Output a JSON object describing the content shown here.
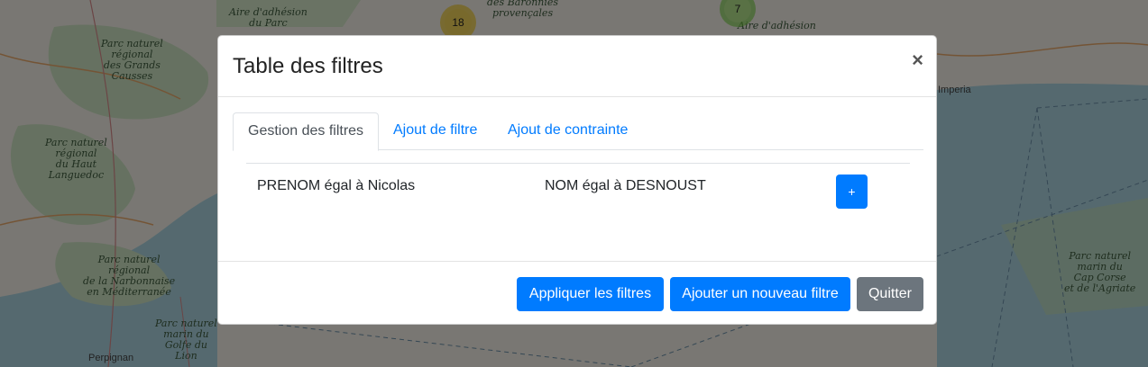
{
  "map": {
    "labels": {
      "aire_parc_1": "Aire d'adhésion\ndu Parc",
      "grands_causses": "Parc naturel\nrégional\ndes Grands\nCausses",
      "haut_languedoc": "Parc naturel\nrégional\ndu Haut\nLanguedoc",
      "narbonnaise": "Parc naturel\nrégional\nde la Narbonnaise\nen Méditerranée",
      "golfe_lion": "Parc naturel\nmarin du\nGolfe du\nLion",
      "baronnies": "des Baronnies\nprovençales",
      "aire_adhesion_2": "Aire d'adhésion",
      "imperia": "Imperia",
      "cap_corse": "Parc naturel\nmarin du\nCap Corse\net de l'Agriate",
      "perpignan": "Perpignan"
    },
    "clusters": {
      "yellow_count": "18",
      "green_count": "7"
    }
  },
  "modal": {
    "title": "Table des filtres",
    "close_symbol": "×",
    "tabs": {
      "gestion": "Gestion des filtres",
      "ajout_filtre": "Ajout de filtre",
      "ajout_contrainte": "Ajout de contrainte"
    },
    "filter": {
      "first": "PRENOM égal à Nicolas",
      "second": "NOM égal à DESNOUST",
      "add_symbol": "+"
    },
    "footer": {
      "apply": "Appliquer les filtres",
      "add_new": "Ajouter un nouveau filtre",
      "quit": "Quitter"
    }
  },
  "colors": {
    "primary": "#007bff",
    "secondary": "#6c757d"
  }
}
